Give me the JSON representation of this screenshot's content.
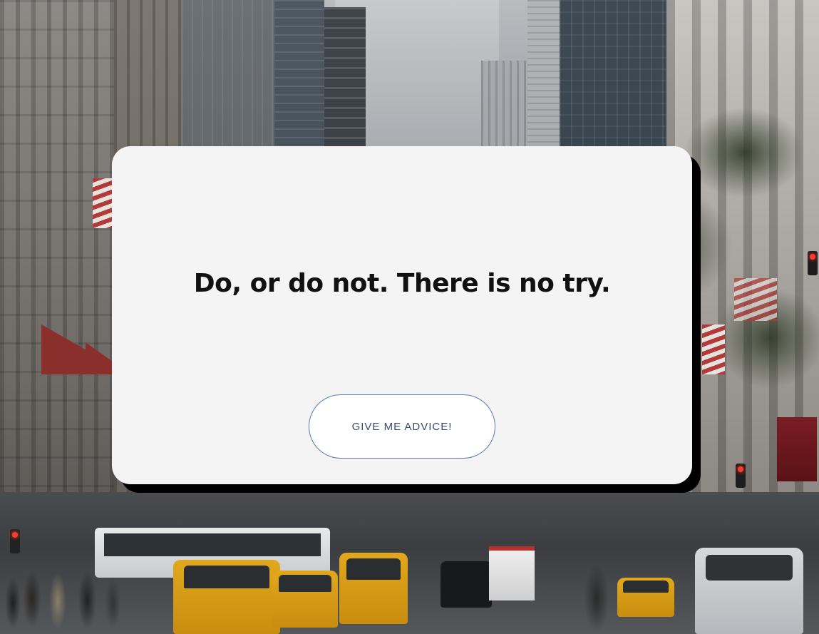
{
  "background": {
    "description_icon": "city-street-photo",
    "accent_colors": {
      "card_background": "#f4f4f4",
      "card_shadow": "#000000",
      "button_border": "#5d79b0",
      "button_text": "#3b4a6b",
      "quote_text": "#111111"
    }
  },
  "card": {
    "quote": "Do, or do not. There is no try.",
    "button_label": "GIVE ME ADVICE!"
  }
}
